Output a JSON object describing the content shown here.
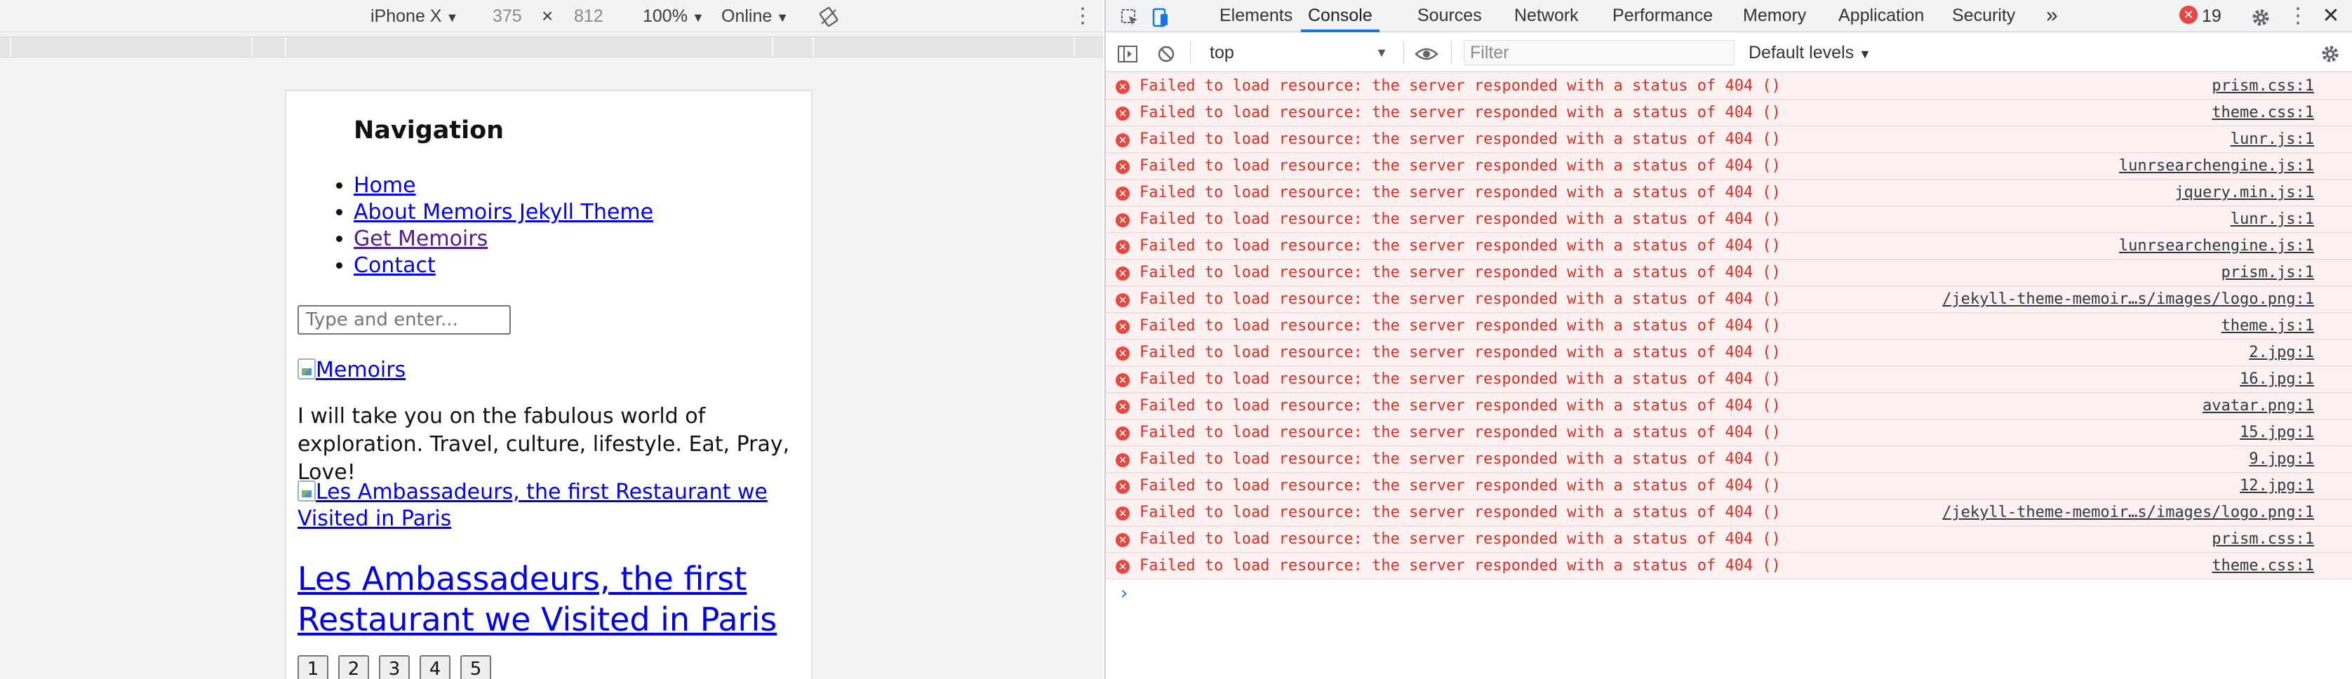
{
  "device_toolbar": {
    "device": "iPhone X",
    "width": "375",
    "times": "×",
    "height": "812",
    "zoom": "100%",
    "network": "Online"
  },
  "page": {
    "nav_title": "Navigation",
    "nav_items": [
      {
        "label": "Home"
      },
      {
        "label": "About Memoirs Jekyll Theme"
      },
      {
        "label": "Get Memoirs"
      },
      {
        "label": "Contact"
      }
    ],
    "search_placeholder": "Type and enter...",
    "logo_alt": "Memoirs",
    "intro": "I will take you on the fabulous world of exploration. Travel, culture, lifestyle. Eat, Pray, Love!",
    "post_image_alt": "Les Ambassadeurs, the first Restaurant we Visited in Paris",
    "post_title": "Les Ambassadeurs, the first Restaurant we Visited in Paris",
    "pager": [
      "1",
      "2",
      "3",
      "4",
      "5"
    ]
  },
  "devtools": {
    "tabs": [
      "Elements",
      "Console",
      "Sources",
      "Network",
      "Performance",
      "Memory",
      "Application",
      "Security"
    ],
    "active_tab": "Console",
    "more_tabs": "»",
    "error_count": "19",
    "context": "top",
    "filter_placeholder": "Filter",
    "levels": "Default levels",
    "prompt": "›",
    "error_color": "#e8473f",
    "accent": "#1a73e8",
    "log": [
      {
        "message": "Failed to load resource: the server responded with a status of 404 ()",
        "source": "prism.css:1"
      },
      {
        "message": "Failed to load resource: the server responded with a status of 404 ()",
        "source": "theme.css:1"
      },
      {
        "message": "Failed to load resource: the server responded with a status of 404 ()",
        "source": "lunr.js:1"
      },
      {
        "message": "Failed to load resource: the server responded with a status of 404 ()",
        "source": "lunrsearchengine.js:1"
      },
      {
        "message": "Failed to load resource: the server responded with a status of 404 ()",
        "source": "jquery.min.js:1"
      },
      {
        "message": "Failed to load resource: the server responded with a status of 404 ()",
        "source": "lunr.js:1"
      },
      {
        "message": "Failed to load resource: the server responded with a status of 404 ()",
        "source": "lunrsearchengine.js:1"
      },
      {
        "message": "Failed to load resource: the server responded with a status of 404 ()",
        "source": "prism.js:1"
      },
      {
        "message": "Failed to load resource: the server responded with a status of 404 ()",
        "source": "/jekyll-theme-memoir…s/images/logo.png:1"
      },
      {
        "message": "Failed to load resource: the server responded with a status of 404 ()",
        "source": "theme.js:1"
      },
      {
        "message": "Failed to load resource: the server responded with a status of 404 ()",
        "source": "2.jpg:1"
      },
      {
        "message": "Failed to load resource: the server responded with a status of 404 ()",
        "source": "16.jpg:1"
      },
      {
        "message": "Failed to load resource: the server responded with a status of 404 ()",
        "source": "avatar.png:1"
      },
      {
        "message": "Failed to load resource: the server responded with a status of 404 ()",
        "source": "15.jpg:1"
      },
      {
        "message": "Failed to load resource: the server responded with a status of 404 ()",
        "source": "9.jpg:1"
      },
      {
        "message": "Failed to load resource: the server responded with a status of 404 ()",
        "source": "12.jpg:1"
      },
      {
        "message": "Failed to load resource: the server responded with a status of 404 ()",
        "source": "/jekyll-theme-memoir…s/images/logo.png:1"
      },
      {
        "message": "Failed to load resource: the server responded with a status of 404 ()",
        "source": "prism.css:1"
      },
      {
        "message": "Failed to load resource: the server responded with a status of 404 ()",
        "source": "theme.css:1"
      }
    ]
  }
}
